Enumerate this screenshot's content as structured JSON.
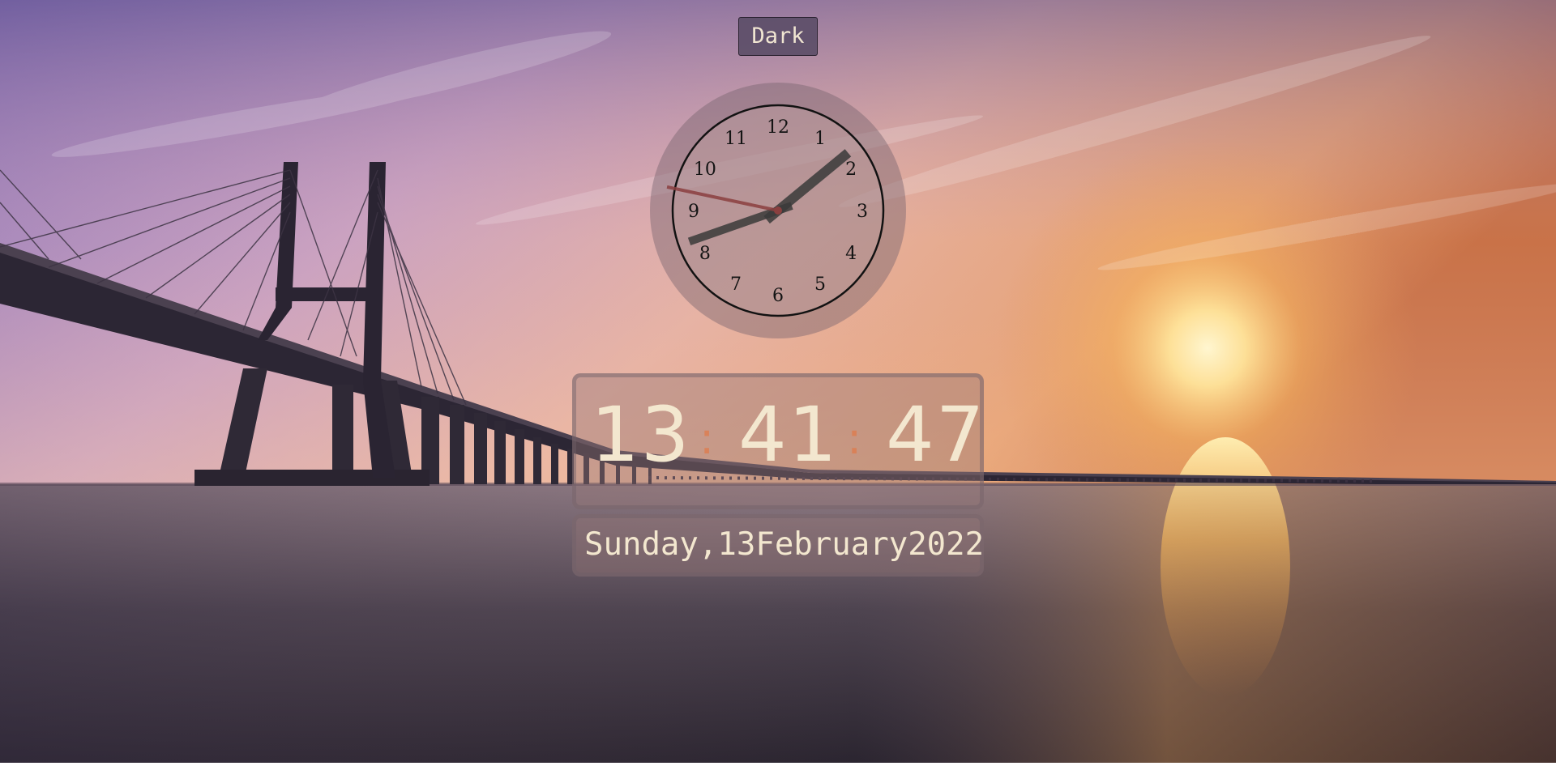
{
  "theme_button": {
    "label": "Dark"
  },
  "analog_clock": {
    "numerals": [
      "12",
      "1",
      "2",
      "3",
      "4",
      "5",
      "6",
      "7",
      "8",
      "9",
      "10",
      "11"
    ],
    "hour": 13,
    "minute": 41,
    "second": 47
  },
  "digital_clock": {
    "hours": "13",
    "minutes": "41",
    "seconds": "47",
    "separator": ":"
  },
  "date": {
    "weekday": "Sunday,",
    "day": "13",
    "month": "February",
    "year": "2022"
  },
  "colors": {
    "text": "#f3e7cf",
    "colon": "#e07a4a",
    "second_hand": "#8a3f3f",
    "hand": "#3a3a3a"
  }
}
